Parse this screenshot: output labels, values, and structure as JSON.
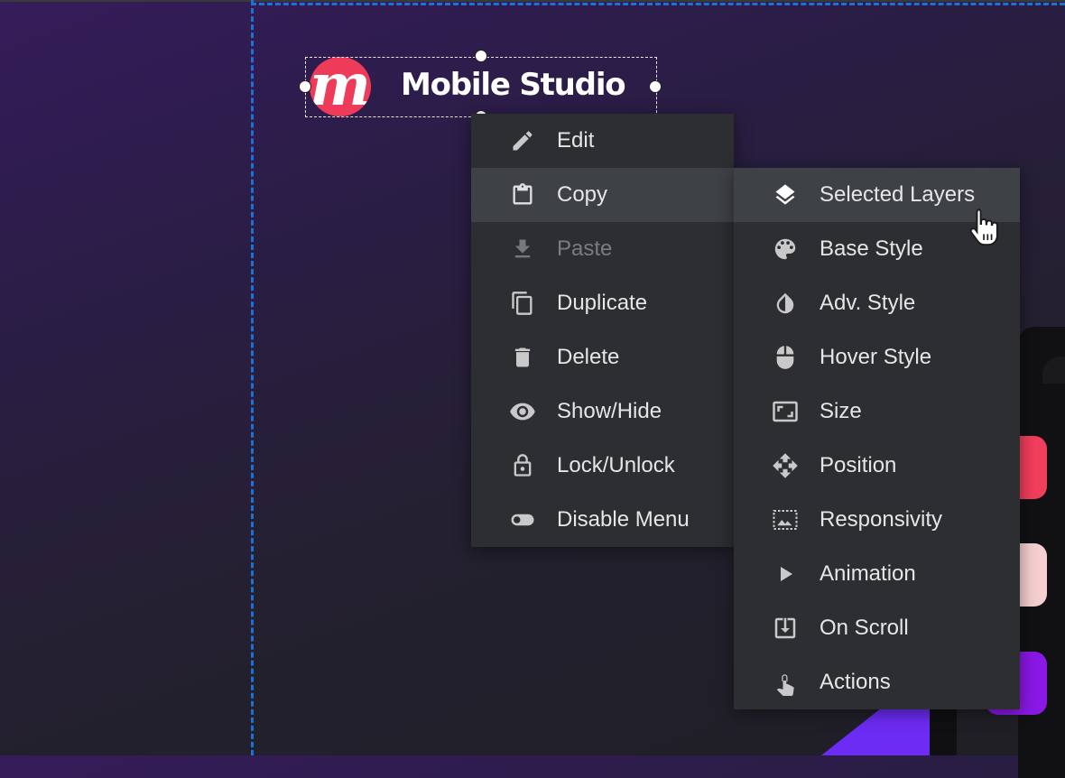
{
  "logo": {
    "mark": "m",
    "text": "Mobile Studio",
    "mark_color": "#ee3b59"
  },
  "context_menu": {
    "items": [
      {
        "label": "Edit",
        "icon": "pencil-icon"
      },
      {
        "label": "Copy",
        "icon": "clipboard-icon",
        "state": "active"
      },
      {
        "label": "Paste",
        "icon": "download-icon",
        "state": "disabled"
      },
      {
        "label": "Duplicate",
        "icon": "copy-icon"
      },
      {
        "label": "Delete",
        "icon": "trash-icon"
      },
      {
        "label": "Show/Hide",
        "icon": "eye-icon"
      },
      {
        "label": "Lock/Unlock",
        "icon": "lock-icon"
      },
      {
        "label": "Disable Menu",
        "icon": "toggle-icon"
      }
    ]
  },
  "copy_submenu": {
    "items": [
      {
        "label": "Selected Layers",
        "icon": "layers-icon",
        "state": "hover"
      },
      {
        "label": "Base Style",
        "icon": "palette-icon"
      },
      {
        "label": "Adv. Style",
        "icon": "contrast-drop-icon"
      },
      {
        "label": "Hover Style",
        "icon": "mouse-icon"
      },
      {
        "label": "Size",
        "icon": "resize-icon"
      },
      {
        "label": "Position",
        "icon": "move-arrows-icon"
      },
      {
        "label": "Responsivity",
        "icon": "responsive-image-icon"
      },
      {
        "label": "Animation",
        "icon": "play-icon"
      },
      {
        "label": "On Scroll",
        "icon": "scroll-download-icon"
      },
      {
        "label": "Actions",
        "icon": "touch-icon"
      }
    ]
  },
  "colors": {
    "menu_bg": "#2c2e31",
    "menu_active": "#3e4146",
    "guide": "#1a72d9",
    "accent_red": "#f23e5d",
    "accent_purple": "#8a18e6"
  }
}
